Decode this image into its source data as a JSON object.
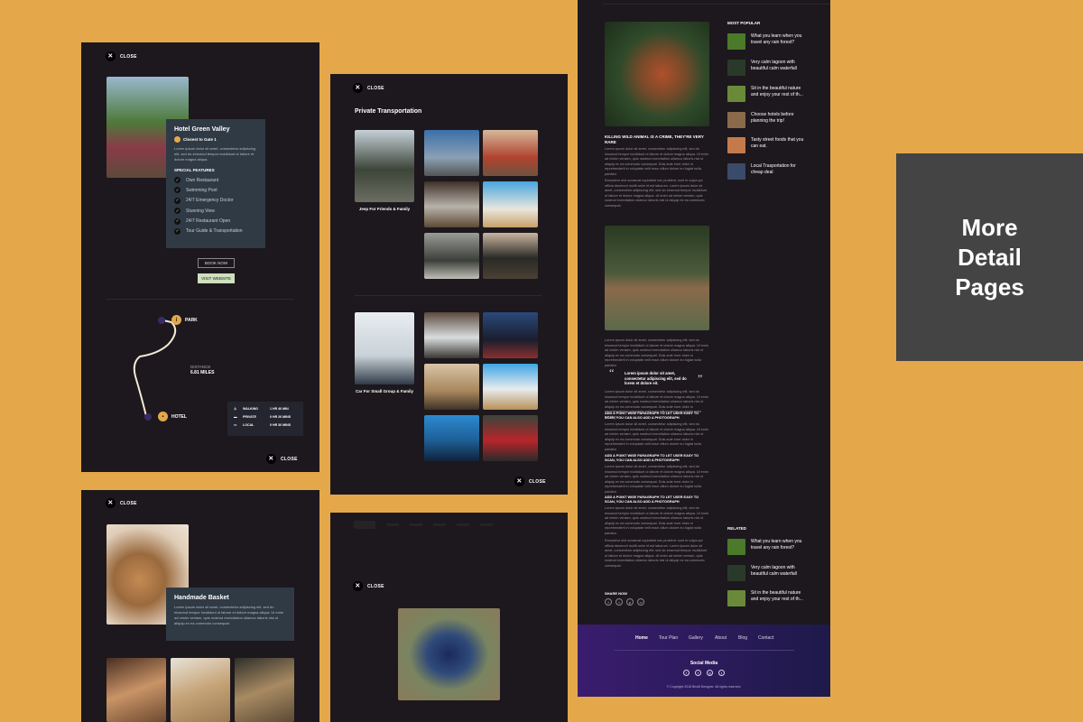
{
  "badge": {
    "line1": "More",
    "line2": "Detail",
    "line3": "Pages"
  },
  "close_label": "CLOSE",
  "close_glyph": "✕",
  "hotel": {
    "name": "Hotel Green Valley",
    "tag": "Closest to Gate 1",
    "desc": "Lorem ipsum dolor sit amet, consectetur adipiscing elit, sed do eiusmod tempor incididunt ut labore et dolore magna aliqua.",
    "features_title": "SPECIAL FEATURES",
    "features": [
      "Own Restaurant",
      "Swimming Pool",
      "24/7 Emergency Doctor",
      "Stunning View",
      "24/7 Restaurant Open",
      "Tour Guide & Transportation"
    ],
    "book": "BOOK NOW",
    "visit": "VISIT WEBSITE"
  },
  "map": {
    "park": "PARK",
    "hotel": "HOTEL",
    "distance_label": "DISTANCE",
    "distance_value": "6.81 MILES",
    "modes": [
      {
        "mode": "WALKING",
        "time": "1 HR 40 MIN"
      },
      {
        "mode": "PRIVATE",
        "time": "0 HR 20 MINS"
      },
      {
        "mode": "LOCAL",
        "time": "0 HR 30 MINS"
      }
    ]
  },
  "transport": {
    "title": "Private Transportation",
    "cap1": "Jeep For Friends & Family",
    "cap2": "Car For Small Group & Family"
  },
  "basket": {
    "title": "Handmade Basket",
    "desc": "Lorem ipsum dolor sit amet, consectetur adipiscing elit, sed do eiusmod tempor incididunt ut labore et dolore magna aliqua. Ut enim ad minim veniam, quis nostrud exercitation ullamco laboris nisi ut aliquip ex ea commodo consequat."
  },
  "blog": {
    "headline": "KILLING WILD ANIMAL IS A CRIME, THEY'RE VERY RARE",
    "lorem": "Lorem ipsum dolor sit amet, consectetur adipiscing elit, sed do eiusmod tempor incididunt ut labore et dolore magna aliqua. Ut enim ad minim veniam, quis nostrud exercitation ullamco laboris nisi ut aliquip ex ea commodo consequat. Duis aute irure dolor in reprehenderit in voluptate velit esse cillum dolore eu fugiat nulla pariatur.",
    "lorem2": "Excepteur sint occaecat cupidatat non proident, sunt in culpa qui officia deserunt mollit anim id est laborum. Lorem ipsum dolor sit amet, consectetur adipiscing elit, sed do eiusmod tempor incididunt ut labore et dolore magna aliqua. Ut enim ad minim veniam, quis nostrud exercitation ullamco laboris nisi ut aliquip ex ea commodo consequat.",
    "quote": "Lorem ipsum dolor sit amet, consectetur adipiscing elit, sed do lorem et dolore eit.",
    "subhead": "ADD A POINT WISE PARAGRAPH TO LET USER EASY TO SCAN, YOU CAN ALSO ADD A PHOTOGRAPH",
    "share": "SHARE NOW",
    "popular_title": "MOST POPULAR",
    "popular": [
      "What you learn when you travel any rain forest?",
      "Very calm lagoon with beautiful calm waterfall",
      "Sit in the beautiful nature and enjoy your rest of th...",
      "Choose hotels before planning the trip!",
      "Tasty street foods that you can eat.",
      "Local Trasportation for cheap deal"
    ],
    "related_title": "RELATED",
    "related": [
      "What you learn when you travel any rain forest?",
      "Very calm lagoon with beautiful calm waterfall",
      "Sit in the beautiful nature and enjoy your rest of th..."
    ]
  },
  "footer": {
    "nav": [
      "Home",
      "Tour Plan",
      "Gallery",
      "About",
      "Blog",
      "Contact"
    ],
    "social_title": "Social Media",
    "copyright": "© Copyright 2018 Brizi8 Designer. All rights reserved."
  },
  "colors": {
    "background": "#e4a84a",
    "panel": "#1d181d",
    "badge": "#444444",
    "accent": "#e4a84a"
  }
}
